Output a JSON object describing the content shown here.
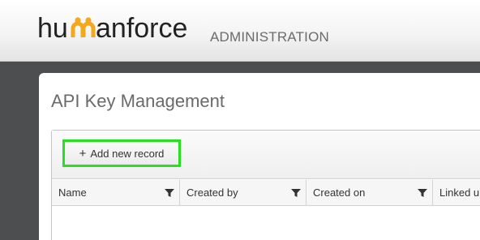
{
  "header": {
    "logo_text": "humanforce",
    "section_label": "ADMINISTRATION",
    "logo_color": "#222222",
    "logo_accent_color": "#f4a81d"
  },
  "page": {
    "title": "API Key Management"
  },
  "toolbar": {
    "add_label": "Add new record",
    "add_icon": "plus-icon",
    "highlight_color": "#27e01f"
  },
  "grid": {
    "columns": [
      {
        "label": "Name",
        "icon": "filter-icon"
      },
      {
        "label": "Created by",
        "icon": "filter-icon"
      },
      {
        "label": "Created on",
        "icon": "filter-icon"
      },
      {
        "label": "Linked u"
      }
    ],
    "rows": []
  }
}
